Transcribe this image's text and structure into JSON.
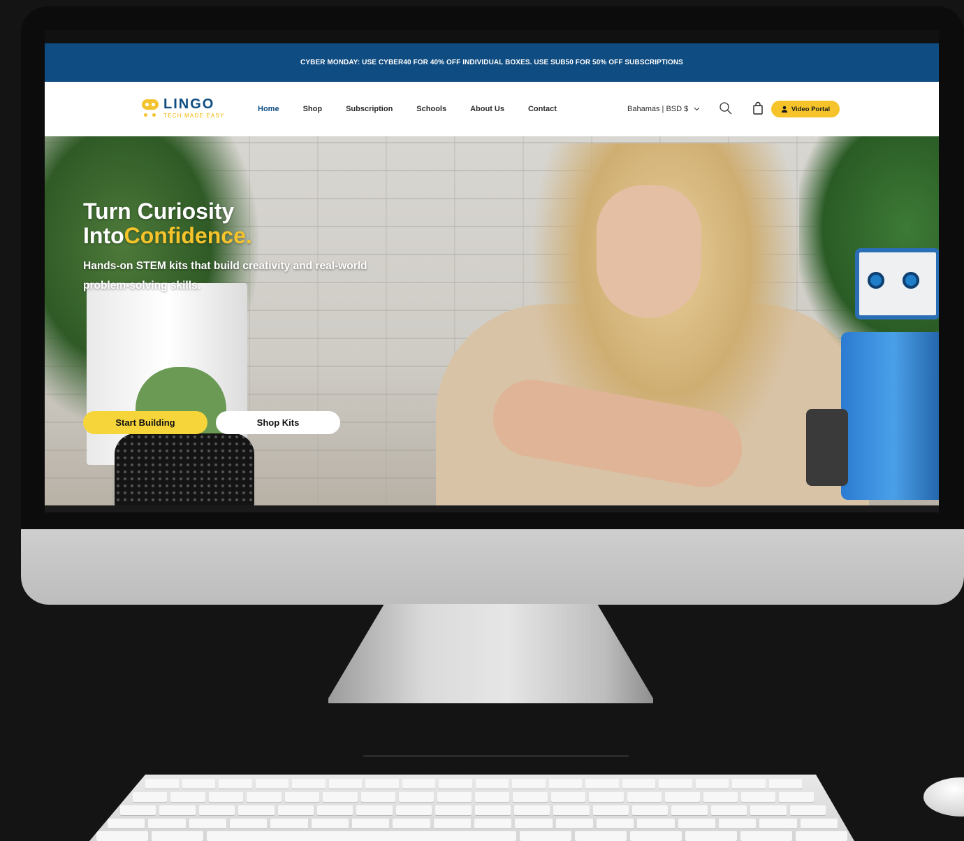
{
  "announcement": {
    "text": "CYBER MONDAY: USE CYBER40 FOR 40% OFF INDIVIDUAL BOXES. USE SUB50 FOR 50% OFF SUBSCRIPTIONS"
  },
  "brand": {
    "name": "LINGO",
    "tagline": "TECH MADE EASY",
    "primary_color": "#0f4c81",
    "accent_color": "#f6c42a"
  },
  "nav": {
    "items": [
      {
        "label": "Home",
        "active": true
      },
      {
        "label": "Shop",
        "active": false
      },
      {
        "label": "Subscription",
        "active": false
      },
      {
        "label": "Schools",
        "active": false
      },
      {
        "label": "About Us",
        "active": false
      },
      {
        "label": "Contact",
        "active": false
      }
    ]
  },
  "header": {
    "country_selector": "Bahamas | BSD $",
    "search_icon": "search-icon",
    "cart_icon": "shopping-bag-icon",
    "portal_label": "Video Portal",
    "portal_icon": "user-icon"
  },
  "hero": {
    "title_line1": "Turn Curiosity",
    "title_line2_plain": "Into",
    "title_line2_accent": "Confidence.",
    "subtitle": "Hands-on STEM kits that build creativity and real-world problem-solving skills.",
    "primary_cta": "Start Building",
    "secondary_cta": "Shop Kits"
  }
}
